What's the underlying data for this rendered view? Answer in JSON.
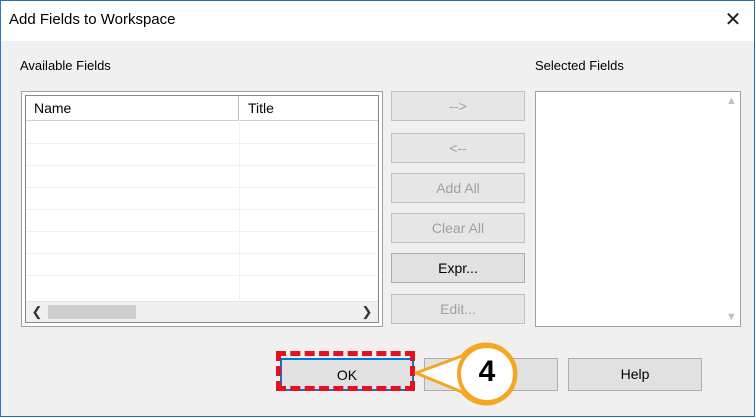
{
  "window": {
    "title": "Add Fields to Workspace",
    "close_glyph": "✕"
  },
  "available": {
    "label": "Available Fields",
    "columns": [
      "Name",
      "Title"
    ],
    "scroll_left": "❮",
    "scroll_right": "❯"
  },
  "selected": {
    "label": "Selected Fields",
    "up": "▲",
    "down": "▼"
  },
  "buttons": {
    "add": "-->",
    "remove": "<--",
    "add_all": "Add All",
    "clear_all": "Clear All",
    "expr": "Expr...",
    "edit": "Edit...",
    "ok": "OK",
    "cancel": "",
    "help": "Help"
  },
  "callout": {
    "number": "4",
    "color": "#e8101c",
    "fill": "#f5a623"
  }
}
